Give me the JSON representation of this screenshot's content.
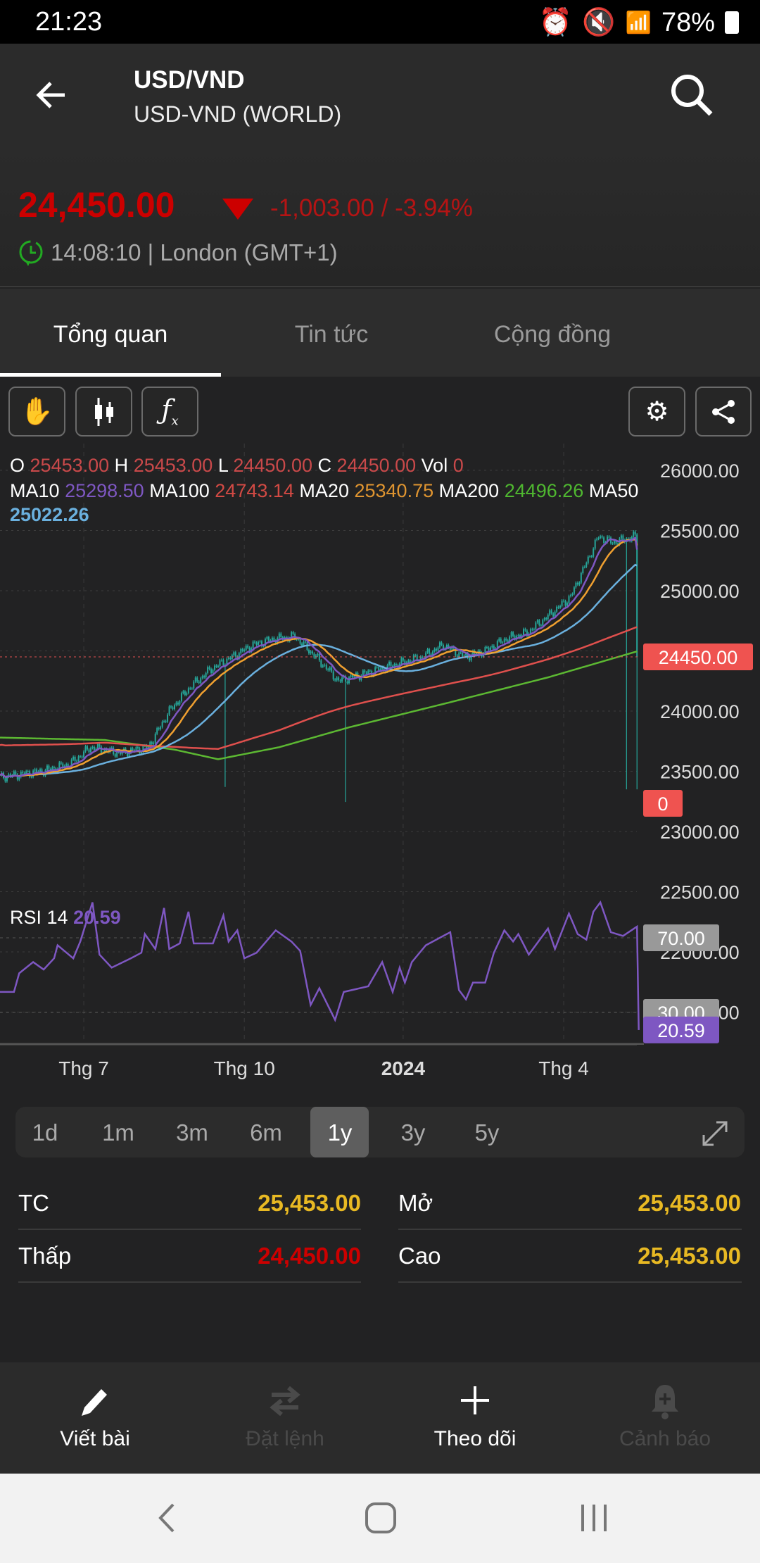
{
  "status_bar": {
    "time": "21:23",
    "battery": "78%"
  },
  "header": {
    "title": "USD/VND",
    "subtitle": "USD-VND (WORLD)"
  },
  "quote": {
    "price": "24,450.00",
    "change": "-1,003.00 / -3.94%",
    "time": "14:08:10 | London (GMT+1)",
    "down_color": "#cc0000"
  },
  "tabs": [
    {
      "label": "Tổng quan"
    },
    {
      "label": "Tin tức"
    },
    {
      "label": "Cộng đồng"
    }
  ],
  "ohlc": {
    "o_label": "O",
    "o": "25453.00",
    "h_label": "H",
    "h": "25453.00",
    "l_label": "L",
    "l": "24450.00",
    "c_label": "C",
    "c": "24450.00",
    "vol_label": "Vol",
    "vol": "0"
  },
  "ma": {
    "ma10_label": "MA10",
    "ma10": "25298.50",
    "ma100_label": "MA100",
    "ma100": "24743.14",
    "ma20_label": "MA20",
    "ma20": "25340.75",
    "ma200_label": "MA200",
    "ma200": "24496.26",
    "ma50_label": "MA50",
    "ma50": "25022.26"
  },
  "rsi": {
    "label": "RSI 14",
    "value": "20.59"
  },
  "chart_data": {
    "type": "line",
    "title": "USD/VND 1y",
    "y_ticks": [
      "26000.00",
      "25500.00",
      "25000.00",
      "24500.00",
      "24000.00",
      "23500.00",
      "23000.00",
      "22500.00",
      "22000.00",
      "21500.00"
    ],
    "y_range": [
      21500,
      26000
    ],
    "x_labels": [
      {
        "label": "Thg 7",
        "day": 48
      },
      {
        "label": "Thg 10",
        "day": 140
      },
      {
        "label": "2024",
        "day": 231,
        "bold": true
      },
      {
        "label": "Thg 4",
        "day": 323
      }
    ],
    "last_price": 24450,
    "last_price_label": "24450.00",
    "volume_label": "0",
    "close": [
      [
        0,
        23450
      ],
      [
        24,
        23500
      ],
      [
        40,
        23560
      ],
      [
        52,
        23700
      ],
      [
        69,
        23650
      ],
      [
        85,
        23700
      ],
      [
        97,
        24000
      ],
      [
        109,
        24200
      ],
      [
        121,
        24350
      ],
      [
        133,
        24450
      ],
      [
        145,
        24550
      ],
      [
        157,
        24600
      ],
      [
        169,
        24620
      ],
      [
        181,
        24450
      ],
      [
        194,
        24250
      ],
      [
        206,
        24300
      ],
      [
        218,
        24350
      ],
      [
        230,
        24400
      ],
      [
        242,
        24450
      ],
      [
        254,
        24550
      ],
      [
        266,
        24450
      ],
      [
        278,
        24500
      ],
      [
        290,
        24600
      ],
      [
        302,
        24650
      ],
      [
        315,
        24800
      ],
      [
        327,
        24950
      ],
      [
        335,
        25200
      ],
      [
        343,
        25450
      ],
      [
        351,
        25400
      ],
      [
        359,
        25430
      ],
      [
        364,
        25453
      ],
      [
        365,
        24450
      ]
    ],
    "spikes": [
      [
        129,
        23370
      ],
      [
        198,
        23245
      ],
      [
        359,
        23350
      ]
    ],
    "ma200": [
      [
        0,
        23780
      ],
      [
        60,
        23760
      ],
      [
        100,
        23680
      ],
      [
        125,
        23600
      ],
      [
        160,
        23700
      ],
      [
        200,
        23865
      ],
      [
        257,
        24070
      ],
      [
        314,
        24280
      ],
      [
        365,
        24496
      ]
    ],
    "rsi": [
      [
        0,
        41
      ],
      [
        8,
        41
      ],
      [
        11,
        51
      ],
      [
        19,
        57
      ],
      [
        25,
        53
      ],
      [
        31,
        59
      ],
      [
        33,
        66
      ],
      [
        42,
        59
      ],
      [
        46,
        68
      ],
      [
        53,
        89
      ],
      [
        57,
        61
      ],
      [
        64,
        54
      ],
      [
        75,
        59
      ],
      [
        81,
        62
      ],
      [
        83,
        72
      ],
      [
        89,
        64
      ],
      [
        94,
        86
      ],
      [
        97,
        64
      ],
      [
        103,
        67
      ],
      [
        108,
        84
      ],
      [
        111,
        67
      ],
      [
        122,
        67
      ],
      [
        128,
        82
      ],
      [
        131,
        68
      ],
      [
        136,
        74
      ],
      [
        140,
        59
      ],
      [
        147,
        62
      ],
      [
        158,
        74
      ],
      [
        167,
        68
      ],
      [
        172,
        63
      ],
      [
        178,
        34
      ],
      [
        183,
        43
      ],
      [
        192,
        26
      ],
      [
        197,
        41
      ],
      [
        211,
        44
      ],
      [
        219,
        57
      ],
      [
        225,
        41
      ],
      [
        229,
        54
      ],
      [
        232,
        46
      ],
      [
        236,
        57
      ],
      [
        244,
        66
      ],
      [
        258,
        73
      ],
      [
        263,
        42
      ],
      [
        267,
        37
      ],
      [
        271,
        46
      ],
      [
        278,
        46
      ],
      [
        283,
        62
      ],
      [
        289,
        74
      ],
      [
        294,
        68
      ],
      [
        297,
        72
      ],
      [
        303,
        61
      ],
      [
        314,
        75
      ],
      [
        318,
        64
      ],
      [
        326,
        83
      ],
      [
        331,
        72
      ],
      [
        336,
        69
      ],
      [
        340,
        84
      ],
      [
        344,
        89
      ],
      [
        350,
        73
      ],
      [
        357,
        71
      ],
      [
        365,
        76
      ],
      [
        366,
        20.59
      ]
    ],
    "rsi_levels": [
      "70.00",
      "30.00"
    ],
    "colors": {
      "candle": "#26a69a",
      "ma10": "#7e57c2",
      "ma100": "#e0504d",
      "ma20": "#f0a030",
      "ma200": "#5cb832",
      "ma50": "#6ab0de",
      "rsi": "#7e57c2"
    }
  },
  "periods": [
    "1d",
    "1m",
    "3m",
    "6m",
    "1y",
    "3y",
    "5y"
  ],
  "active_period": "1y",
  "stats": {
    "tc_label": "TC",
    "tc": "25,453.00",
    "low_label": "Thấp",
    "low": "24,450.00",
    "open_label": "Mở",
    "open": "25,453.00",
    "high_label": "Cao",
    "high": "25,453.00"
  },
  "bottom_nav": [
    {
      "label": "Viết bài"
    },
    {
      "label": "Đặt lệnh"
    },
    {
      "label": "Theo dõi"
    },
    {
      "label": "Cảnh báo"
    }
  ]
}
